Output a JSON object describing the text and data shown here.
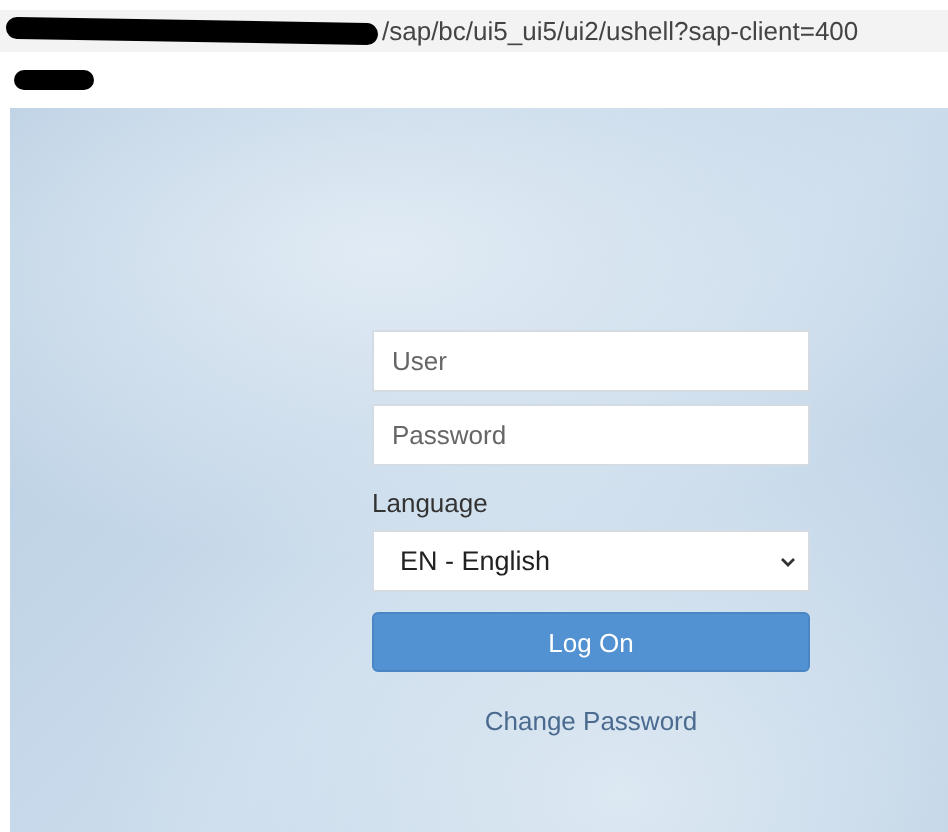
{
  "address_bar": {
    "url": "/sap/bc/ui5_ui5/ui2/ushell?sap-client=400"
  },
  "login": {
    "user": {
      "placeholder": "User"
    },
    "password": {
      "placeholder": "Password"
    },
    "language": {
      "label": "Language",
      "value": "EN - English"
    },
    "submit": "Log On",
    "link": "Change Password"
  }
}
